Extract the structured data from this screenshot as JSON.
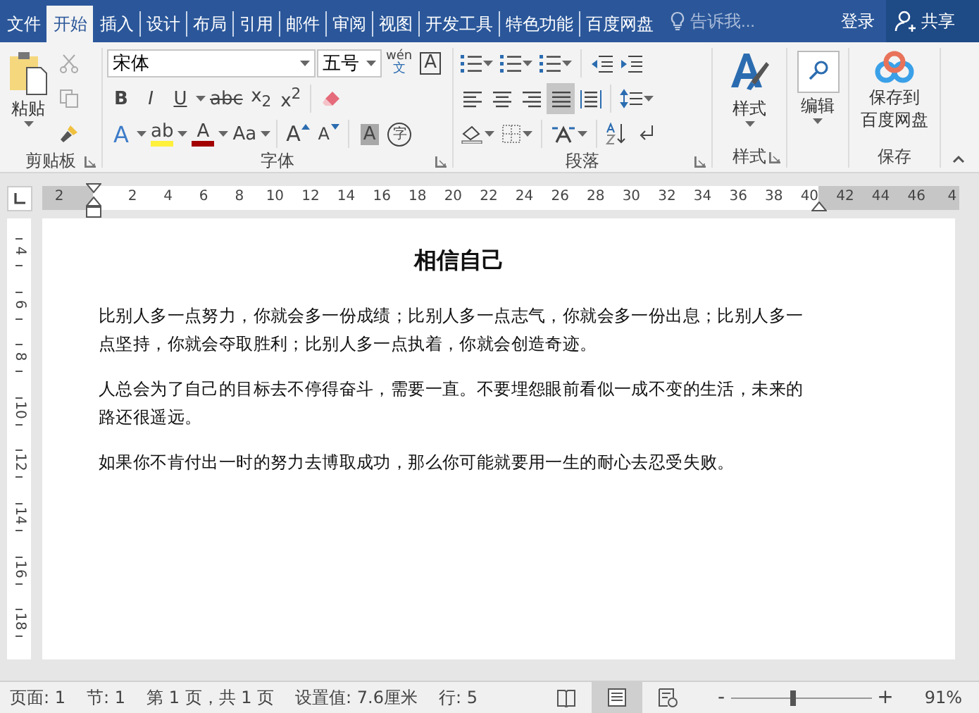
{
  "tabs": [
    {
      "label": "文件",
      "selected": false
    },
    {
      "label": "开始",
      "selected": true
    },
    {
      "label": "插入",
      "selected": false
    },
    {
      "label": "设计",
      "selected": false
    },
    {
      "label": "布局",
      "selected": false
    },
    {
      "label": "引用",
      "selected": false
    },
    {
      "label": "邮件",
      "selected": false
    },
    {
      "label": "审阅",
      "selected": false
    },
    {
      "label": "视图",
      "selected": false
    },
    {
      "label": "开发工具",
      "selected": false
    },
    {
      "label": "特色功能",
      "selected": false
    },
    {
      "label": "百度网盘",
      "selected": false
    }
  ],
  "tell_me": {
    "placeholder": "告诉我..."
  },
  "sign_in": "登录",
  "share": "共享",
  "clipboard": {
    "label": "剪贴板",
    "paste": "粘贴",
    "tools": [
      {
        "kind": "cut",
        "disabled": true
      },
      {
        "kind": "copy",
        "disabled": true
      },
      {
        "kind": "painter",
        "disabled": false
      }
    ]
  },
  "font": {
    "label": "字体",
    "name": "宋体",
    "size": "五号",
    "phonetic": "wén",
    "phonetic_char": "文",
    "border_char": "A",
    "format": [
      {
        "kind": "bold",
        "text": "B"
      },
      {
        "kind": "italic",
        "text": "I"
      },
      {
        "kind": "underline",
        "text": "U"
      },
      {
        "kind": "strike",
        "text": "abc"
      },
      {
        "kind": "subscript",
        "text": "x$_{2}$"
      },
      {
        "kind": "superscript",
        "text": "x$^{2}$"
      }
    ],
    "effects": [
      {
        "kind": "text-effect",
        "text": "A"
      },
      {
        "kind": "highlight",
        "text": "ab",
        "color": "#fff03c"
      },
      {
        "kind": "font-color",
        "text": "A",
        "color": "#a30000"
      },
      {
        "kind": "case",
        "text": "Aa"
      }
    ],
    "sizing": [
      {
        "kind": "grow",
        "text": "A"
      },
      {
        "kind": "shrink",
        "text": "A"
      }
    ],
    "char": [
      {
        "kind": "shading",
        "text": "A"
      },
      {
        "kind": "enclose",
        "text": "字"
      }
    ]
  },
  "paragraph": {
    "label": "段落",
    "alignments": [
      {
        "kind": "left",
        "selected": false
      },
      {
        "kind": "center",
        "selected": false
      },
      {
        "kind": "right",
        "selected": false
      },
      {
        "kind": "justify",
        "selected": true
      },
      {
        "kind": "distribute",
        "selected": false
      }
    ]
  },
  "styles": {
    "label": "样式",
    "button": "样式"
  },
  "editing": {
    "button": "编辑"
  },
  "save": {
    "label": "保存",
    "lines": [
      "保存到",
      "百度网盘"
    ]
  },
  "ruler": {
    "numbers": [
      "2",
      "2",
      "4",
      "6",
      "8",
      "10",
      "12",
      "14",
      "16",
      "18",
      "20",
      "22",
      "24",
      "26",
      "28",
      "30",
      "32",
      "34",
      "36",
      "38",
      "40",
      "42",
      "44",
      "46",
      "4"
    ]
  },
  "vertical_ruler": {
    "numbers": [
      "4",
      "6",
      "8",
      "10",
      "12",
      "14",
      "16",
      "18"
    ]
  },
  "document": {
    "title": "相信自己",
    "paragraphs": [
      "比别人多一点努力，你就会多一份成绩；比别人多一点志气，你就会多一份出息；比别人多一点坚持，你就会夺取胜利；比别人多一点执着，你就会创造奇迹。",
      "人总会为了自己的目标去不停得奋斗，需要一直。不要埋怨眼前看似一成不变的生活，未来的路还很遥远。",
      "如果你不肯付出一时的努力去博取成功，那么你可能就要用一生的耐心去忍受失败。"
    ]
  },
  "status": {
    "items": [
      "页面: 1",
      "节: 1",
      "第 1 页，共 1 页",
      "设置值: 7.6厘米",
      "行: 5"
    ],
    "views": [
      {
        "kind": "read",
        "selected": false
      },
      {
        "kind": "print",
        "selected": true
      },
      {
        "kind": "web",
        "selected": false
      }
    ],
    "zoom_out": "-",
    "zoom_in": "+",
    "zoom": {
      "level": 0.44
    },
    "zoom_reading": "91%"
  }
}
